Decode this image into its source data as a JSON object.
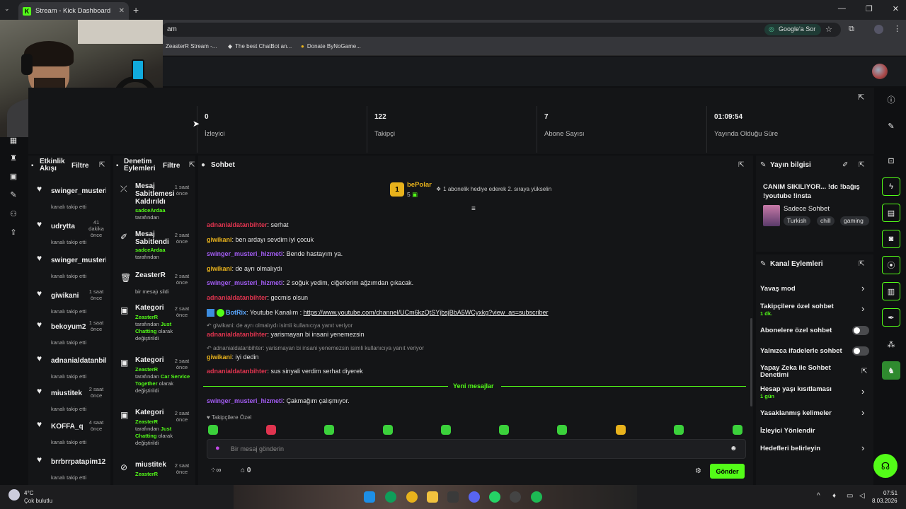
{
  "browser": {
    "tab_title": "Stream - Kick Dashboard",
    "address_fragment": "am",
    "google_button": "Google'a Sor",
    "bookmarks": [
      "ZeasterR Stream -...",
      "The best ChatBot an...",
      "Donate ByNoGame..."
    ]
  },
  "stats": [
    {
      "value": "0",
      "label": "İzleyici"
    },
    {
      "value": "122",
      "label": "Takipçi"
    },
    {
      "value": "7",
      "label": "Abone Sayısı"
    },
    {
      "value": "01:09:54",
      "label": "Yayında Olduğu Süre"
    }
  ],
  "activity": {
    "title": "Etkinlik Akışı",
    "filter": "Filtre",
    "items": [
      {
        "name": "swinger_musteri",
        "sub": "kanalı takip etti",
        "time": ""
      },
      {
        "name": "udrytta",
        "sub": "kanalı takip etti",
        "time": "41 dakika önce"
      },
      {
        "name": "swinger_musteri",
        "sub": "kanalı takip etti",
        "time": ""
      },
      {
        "name": "giwikani",
        "sub": "kanalı takip etti",
        "time": "1 saat önce"
      },
      {
        "name": "bekoyum2",
        "sub": "kanalı takip etti",
        "time": "1 saat önce"
      },
      {
        "name": "adnanialdatanbil",
        "sub": "kanalı takip etti",
        "time": ""
      },
      {
        "name": "miustitek",
        "sub": "kanalı takip etti",
        "time": "2 saat önce"
      },
      {
        "name": "KOFFA_q",
        "sub": "kanalı takip etti",
        "time": "4 saat önce"
      },
      {
        "name": "brrbrrpatapim12",
        "sub": "kanalı takip etti",
        "time": ""
      }
    ]
  },
  "moderation": {
    "title": "Denetim Eylemleri",
    "filter": "Filtre",
    "items": [
      {
        "title": "Mesaj Sabitlemesi Kaldırıldı",
        "l1": "sadceArdaa",
        "l2": "tarafından",
        "l3": "",
        "l4": "",
        "time": "1 saat önce"
      },
      {
        "title": "Mesaj Sabitlendi",
        "l1": "sadceArdaa",
        "l2": "tarafından",
        "l3": "",
        "l4": "",
        "time": "2 saat önce"
      },
      {
        "title": "ZeasterR",
        "l1": "",
        "l2": "bir mesajı sildi",
        "l3": "",
        "l4": "",
        "time": "2 saat önce"
      },
      {
        "title": "Kategori",
        "l1": "ZeasterR",
        "l2": "tarafından",
        "l3": "Just Chatting",
        "l4": "olarak değiştirildi",
        "time": "2 saat önce"
      },
      {
        "title": "Kategori",
        "l1": "ZeasterR",
        "l2": "tarafından",
        "l3": "Car Service Together",
        "l4": "olarak değiştirildi",
        "time": "2 saat önce"
      },
      {
        "title": "Kategori",
        "l1": "ZeasterR",
        "l2": "tarafından",
        "l3": "Just Chatting",
        "l4": "olarak değiştirildi",
        "time": "2 saat önce"
      },
      {
        "title": "miustitek",
        "l1": "ZeasterR",
        "l2": "",
        "l3": "",
        "l4": "",
        "time": "2 saat önce"
      }
    ]
  },
  "chat": {
    "title": "Sohbet",
    "pinned_user": "bePolar",
    "pinned_count": "5",
    "pinned_rank": "1",
    "pinned_text": "1 abonelik hediye ederek 2. sıraya yükselin",
    "messages": [
      {
        "user": "adnanialdatanbihter",
        "color": "red",
        "text": "serhat"
      },
      {
        "user": "giwikani",
        "color": "yel",
        "text": "ben ardayı sevdim iyi çocuk"
      },
      {
        "user": "swinger_musteri_hizmeti",
        "color": "pur",
        "text": "Bende hastayım ya."
      },
      {
        "user": "giwikani",
        "color": "yel",
        "text": "de ayrı olmalıydı"
      },
      {
        "user": "swinger_musteri_hizmeti",
        "color": "pur",
        "text": "2 soğuk yedim, ciğerlerim ağzımdan çıkacak."
      },
      {
        "user": "adnanialdatanbihter",
        "color": "red",
        "text": "gecmis olsun"
      }
    ],
    "bot_user": "BotRix",
    "bot_text": "Youtube Kanalım : ",
    "bot_link": "https://www.youtube.com/channel/UCm6kzQtSYjbsjBbA5WCyxkg?view_as=subscriber",
    "reply1": "giwikani: de ayrı olmalıydı isimli kullanıcıya yanıt veriyor",
    "reply1_user": "adnanialdatanbihter",
    "reply1_text": "yarismayan bi insani yenemezsin",
    "reply2": "adnanialdatanbihter: yarismayan bi insani yenemezsin isimli kullanıcıya yanıt veriyor",
    "reply2_user": "giwikani",
    "reply2_text": "iyi dedin",
    "after_user": "adnanialdatanbihter",
    "after_text": "sus sinyali verdim serhat diyerek",
    "new_messages": "Yeni mesajlar",
    "last_user": "swinger_musteri_hizmeti",
    "last_text": "Çakmağım çalışmıyor.",
    "followers_only": "Takipçilere Özel",
    "input_placeholder": "Bir mesaj gönderin",
    "infinity": "∞",
    "shop_count": "0",
    "send": "Gönder"
  },
  "stream_info": {
    "title": "Yayın bilgisi",
    "stream_title": "CANIM SIKILIYOR... !dc !bağış !youtube !insta",
    "category": "Sadece Sohbet",
    "tags": [
      "Turkish",
      "chill",
      "gaming"
    ]
  },
  "channel_actions": {
    "title": "Kanal Eylemleri",
    "slow_mode": "Yavaş mod",
    "followers_chat": "Takipçilere özel sohbet",
    "followers_chat_sub": "1 dk.",
    "subs_chat": "Abonelere özel sohbet",
    "emote_chat": "Yalnızca ifadelerle sohbet",
    "ai_mod": "Yapay Zeka ile Sohbet Denetimi",
    "age_limit": "Hesap yaşı kısıtlaması",
    "age_limit_sub": "1 gün",
    "banned_words": "Yasaklanmış kelimeler",
    "raid": "İzleyici Yönlendir",
    "goals": "Hedefleri belirleyin"
  },
  "taskbar": {
    "weather_temp": "4°C",
    "weather_desc": "Çok bulutlu",
    "time": "07:51",
    "date": "8.03.2026"
  },
  "colors": {
    "accent": "#53fc18",
    "panel": "#141517"
  }
}
